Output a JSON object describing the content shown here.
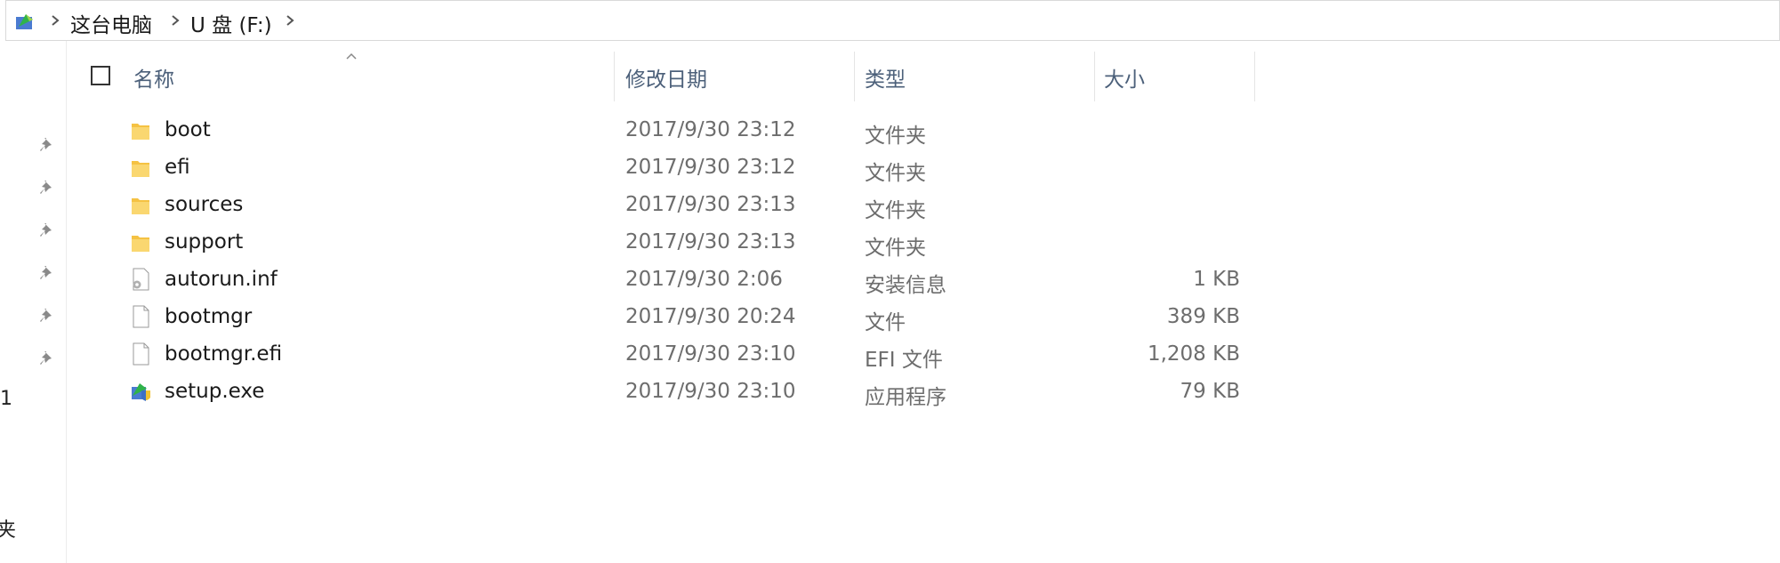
{
  "breadcrumb": {
    "items": [
      "这台电脑",
      "U 盘 (F:)"
    ]
  },
  "columns": {
    "name": "名称",
    "date": "修改日期",
    "type": "类型",
    "size": "大小"
  },
  "left_fragments": [
    "1",
    "夹"
  ],
  "files": [
    {
      "name": "boot",
      "date": "2017/9/30 23:12",
      "type": "文件夹",
      "size": "",
      "icon": "folder-icon"
    },
    {
      "name": "efi",
      "date": "2017/9/30 23:12",
      "type": "文件夹",
      "size": "",
      "icon": "folder-icon"
    },
    {
      "name": "sources",
      "date": "2017/9/30 23:13",
      "type": "文件夹",
      "size": "",
      "icon": "folder-icon"
    },
    {
      "name": "support",
      "date": "2017/9/30 23:13",
      "type": "文件夹",
      "size": "",
      "icon": "folder-icon"
    },
    {
      "name": "autorun.inf",
      "date": "2017/9/30 2:06",
      "type": "安装信息",
      "size": "1 KB",
      "icon": "settings-file-icon"
    },
    {
      "name": "bootmgr",
      "date": "2017/9/30 20:24",
      "type": "文件",
      "size": "389 KB",
      "icon": "file-icon"
    },
    {
      "name": "bootmgr.efi",
      "date": "2017/9/30 23:10",
      "type": "EFI 文件",
      "size": "1,208 KB",
      "icon": "file-icon"
    },
    {
      "name": "setup.exe",
      "date": "2017/9/30 23:10",
      "type": "应用程序",
      "size": "79 KB",
      "icon": "setup-app-icon"
    }
  ],
  "colors": {
    "header_text": "#4c607a",
    "folder": "#f5c243",
    "muted_text": "#6d6d6d"
  }
}
